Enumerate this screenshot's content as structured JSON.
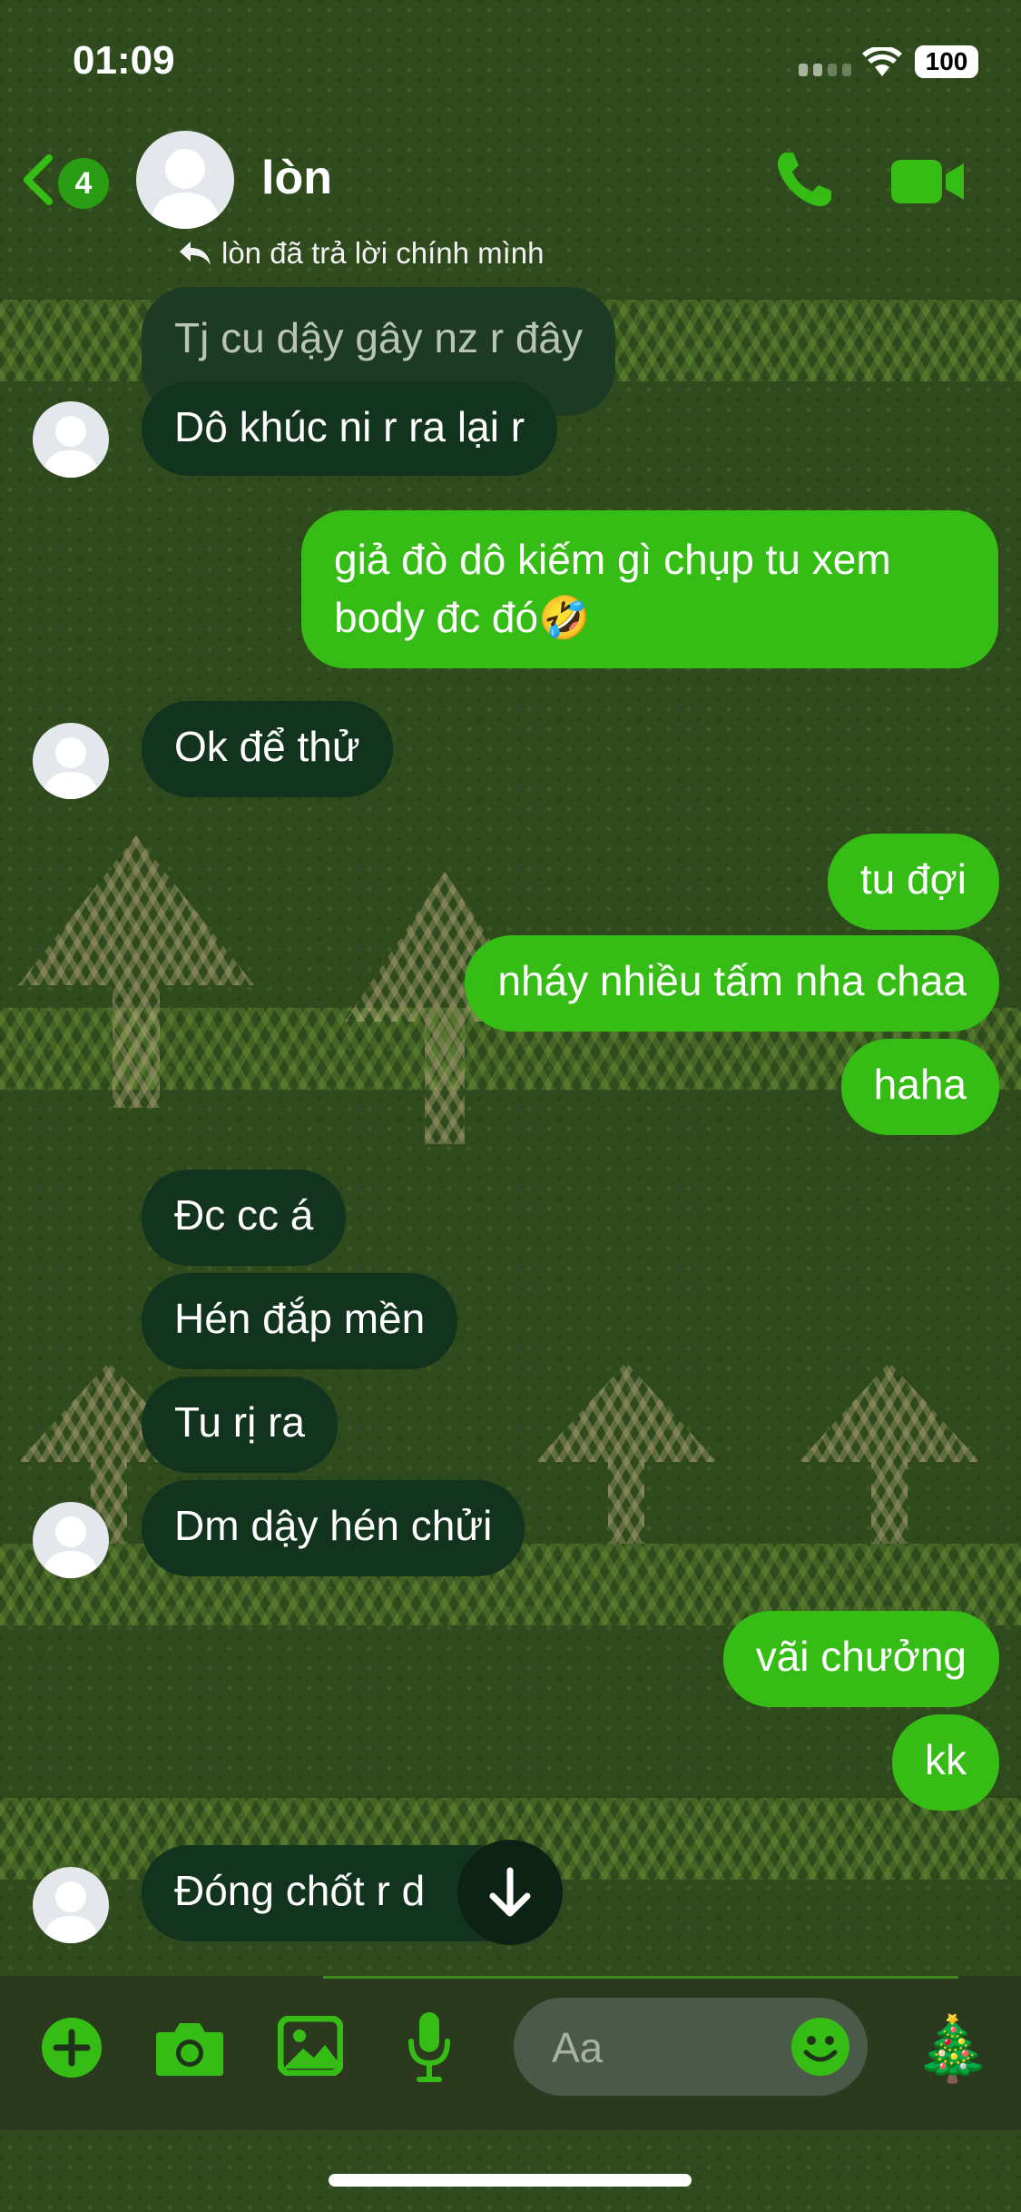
{
  "status_bar": {
    "time": "01:09",
    "battery": "100"
  },
  "header": {
    "unread_count": "4",
    "contact_name": "lòn",
    "reply_note": "lòn đã trả lời chính mình"
  },
  "messages": [
    {
      "side": "in",
      "text": "Tj cu dậy gây nz r đây",
      "quoted": true
    },
    {
      "side": "in",
      "text": "Dô khúc ni r ra lại r"
    },
    {
      "side": "out",
      "line1": "giả đò dô kiếm gì chụp tu xem",
      "line2": "body đc đó🤣"
    },
    {
      "side": "in",
      "text": "Ok để thử"
    },
    {
      "side": "out",
      "text": "tu đợi"
    },
    {
      "side": "out",
      "text": "nháy nhiều tấm nha chaa"
    },
    {
      "side": "out",
      "text": "haha"
    },
    {
      "side": "in",
      "text": "Đc cc á"
    },
    {
      "side": "in",
      "text": "Hén đắp mền"
    },
    {
      "side": "in",
      "text": "Tu rị ra"
    },
    {
      "side": "in",
      "text": "Dm dậy hén chửi"
    },
    {
      "side": "out",
      "text": "vãi chưởng"
    },
    {
      "side": "out",
      "text": "kk"
    },
    {
      "side": "in",
      "text": "Đóng chốt r d"
    }
  ],
  "composer": {
    "placeholder": "Aa",
    "tree_emoji": "🎄"
  },
  "icons": {
    "back": "chevron-left-icon",
    "call": "phone-icon",
    "video": "video-camera-icon",
    "plus": "plus-circle-icon",
    "camera": "camera-icon",
    "gallery": "image-icon",
    "mic": "microphone-icon",
    "emoji": "smiley-icon",
    "scroll": "arrow-down-icon"
  },
  "colors": {
    "accent": "#36bd15",
    "incoming_bubble": "#12341f",
    "background": "#2f4a1c"
  }
}
